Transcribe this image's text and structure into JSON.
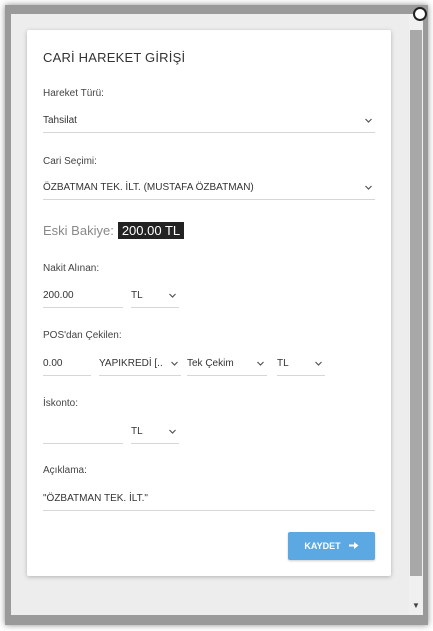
{
  "form": {
    "title": "CARİ HAREKET GİRİŞİ",
    "hareket_turu": {
      "label": "Hareket Türü:",
      "value": "Tahsilat"
    },
    "cari_secimi": {
      "label": "Cari Seçimi:",
      "value": "ÖZBATMAN TEK. İLT. (MUSTAFA ÖZBATMAN)"
    },
    "eski_bakiye": {
      "label": "Eski Bakiye:",
      "value": "200.00 TL"
    },
    "nakit": {
      "label": "Nakit Alınan:",
      "amount": "200.00",
      "currency": "TL"
    },
    "pos": {
      "label": "POS'dan Çekilen:",
      "amount": "0.00",
      "bank": "YAPIKREDİ [...",
      "installment": "Tek Çekim",
      "currency": "TL"
    },
    "iskonto": {
      "label": "İskonto:",
      "amount": "",
      "currency": "TL"
    },
    "aciklama": {
      "label": "Açıklama:",
      "value": "\"ÖZBATMAN TEK. İLT.\""
    },
    "save_label": "KAYDET"
  },
  "icons": {
    "dropdown": "chevron-down-icon",
    "save": "arrow-right-icon"
  }
}
